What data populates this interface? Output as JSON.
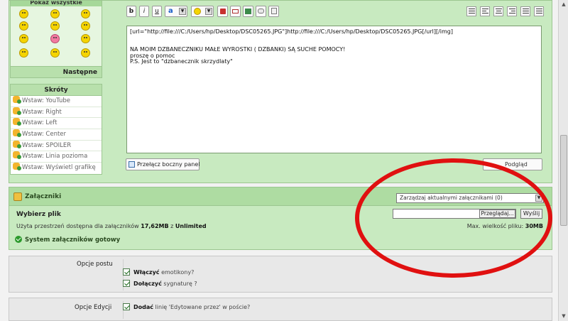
{
  "smileys": {
    "heading": "Pokaż wszystkie",
    "next_label": "Następne"
  },
  "shortcuts": {
    "heading": "Skróty",
    "items": [
      "Wstaw: YouTube",
      "Wstaw: Right",
      "Wstaw: Left",
      "Wstaw: Center",
      "Wstaw: SPOILER",
      "Wstaw: Linia pozioma",
      "Wstaw: Wyświetl grafikę"
    ]
  },
  "toolbar": {
    "bold": "b",
    "italic": "i",
    "underline": "u",
    "font_color": "a"
  },
  "editor": {
    "content": "[url=\"http://file:///C:/Users/hp/Desktop/DSC05265.JPG\"]http://file:///C:/Users/hp/Desktop/DSC05265.JPG[/url][/img]\n\n\nNA MOIM DZBANECZNIKU MAŁE WYROSTKI ( DZBANKI) SĄ SUCHE POMOCY!\nproszę o pomoc\nP.S. Jest to \"dzbanecznik skrzydlaty\"",
    "toggle_panel_label": "Przełącz boczny panel",
    "right_button_label": "Podgląd"
  },
  "attachments": {
    "title": "Załączniki",
    "manage_select": "Zarządzaj aktualnymi załącznikami (0)",
    "choose_file_label": "Wybierz plik",
    "browse_button": "Przeglądaj...",
    "send_button": "Wyślij",
    "space_prefix": "Użyta przestrzeń dostępna dla załączników ",
    "space_used": "17,62MB",
    "space_mid": " z ",
    "space_total": "Unlimited",
    "max_size_label": "Max. wielkość pliku: ",
    "max_size_value": "30MB",
    "status": "System załączników gotowy"
  },
  "post_options": {
    "label": "Opcje postu",
    "enable_emoticons_bold": "Włączyć",
    "enable_emoticons_rest": " emotikony?",
    "attach_signature_bold": "Dołączyć",
    "attach_signature_rest": " sygnaturę ?"
  },
  "edit_options": {
    "label": "Opcje Edycji",
    "add_line_bold": "Dodać",
    "add_line_rest": " linię 'Edytowane przez' w poście?"
  },
  "colors": {
    "panel_green": "#c8eac0",
    "header_green": "#aedca2",
    "annotation_red": "#e01010"
  }
}
